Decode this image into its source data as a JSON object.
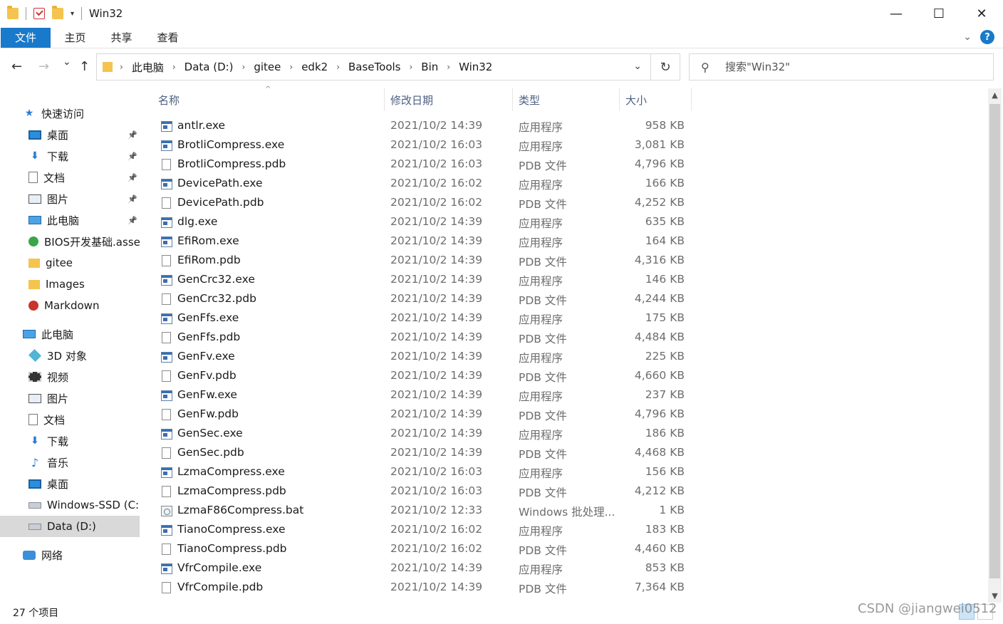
{
  "window": {
    "title": "Win32",
    "controls": {
      "minimize": "—",
      "maximize": "☐",
      "close": "✕"
    }
  },
  "ribbon": {
    "file_tab": "文件",
    "tabs": [
      "主页",
      "共享",
      "查看"
    ],
    "help": "?"
  },
  "nav": {
    "back": "←",
    "forward": "→",
    "recent": "⌄",
    "up": "↑",
    "breadcrumbs": [
      "此电脑",
      "Data (D:)",
      "gitee",
      "edk2",
      "BaseTools",
      "Bin",
      "Win32"
    ],
    "refresh": "↻",
    "search_placeholder": "搜索\"Win32\""
  },
  "sidebar": {
    "items": [
      {
        "label": "快速访问",
        "icon": "star-icon",
        "indent": 0,
        "pinned": false,
        "selected": false
      },
      {
        "label": "桌面",
        "icon": "desktop-icon",
        "indent": 1,
        "pinned": true,
        "selected": false
      },
      {
        "label": "下载",
        "icon": "download-icon",
        "indent": 1,
        "pinned": true,
        "selected": false
      },
      {
        "label": "文档",
        "icon": "document-icon",
        "indent": 1,
        "pinned": true,
        "selected": false
      },
      {
        "label": "图片",
        "icon": "picture-icon",
        "indent": 1,
        "pinned": true,
        "selected": false
      },
      {
        "label": "此电脑",
        "icon": "computer-icon",
        "indent": 1,
        "pinned": true,
        "selected": false
      },
      {
        "label": "BIOS开发基础.assets",
        "icon": "green-circle-icon",
        "indent": 1,
        "pinned": false,
        "selected": false
      },
      {
        "label": "gitee",
        "icon": "folder-icon",
        "indent": 1,
        "pinned": false,
        "selected": false
      },
      {
        "label": "Images",
        "icon": "folder-icon",
        "indent": 1,
        "pinned": false,
        "selected": false
      },
      {
        "label": "Markdown",
        "icon": "red-circle-icon",
        "indent": 1,
        "pinned": false,
        "selected": false
      },
      {
        "label": "此电脑",
        "icon": "computer-icon",
        "indent": 0,
        "pinned": false,
        "selected": false
      },
      {
        "label": "3D 对象",
        "icon": "cube-3d-icon",
        "indent": 1,
        "pinned": false,
        "selected": false
      },
      {
        "label": "视频",
        "icon": "video-icon",
        "indent": 1,
        "pinned": false,
        "selected": false
      },
      {
        "label": "图片",
        "icon": "picture-icon",
        "indent": 1,
        "pinned": false,
        "selected": false
      },
      {
        "label": "文档",
        "icon": "document-icon",
        "indent": 1,
        "pinned": false,
        "selected": false
      },
      {
        "label": "下载",
        "icon": "download-icon",
        "indent": 1,
        "pinned": false,
        "selected": false
      },
      {
        "label": "音乐",
        "icon": "music-icon",
        "indent": 1,
        "pinned": false,
        "selected": false
      },
      {
        "label": "桌面",
        "icon": "desktop-icon",
        "indent": 1,
        "pinned": false,
        "selected": false
      },
      {
        "label": "Windows-SSD (C:)",
        "icon": "drive-icon",
        "indent": 1,
        "pinned": false,
        "selected": false
      },
      {
        "label": "Data (D:)",
        "icon": "drive-icon",
        "indent": 1,
        "pinned": false,
        "selected": true
      },
      {
        "label": "网络",
        "icon": "network-icon",
        "indent": 0,
        "pinned": false,
        "selected": false
      }
    ]
  },
  "columns": {
    "name": "名称",
    "date": "修改日期",
    "type": "类型",
    "size": "大小"
  },
  "files": [
    {
      "name": "antlr.exe",
      "date": "2021/10/2 14:39",
      "type": "应用程序",
      "size": "958 KB",
      "kind": "exe"
    },
    {
      "name": "BrotliCompress.exe",
      "date": "2021/10/2 16:03",
      "type": "应用程序",
      "size": "3,081 KB",
      "kind": "exe"
    },
    {
      "name": "BrotliCompress.pdb",
      "date": "2021/10/2 16:03",
      "type": "PDB 文件",
      "size": "4,796 KB",
      "kind": "pdb"
    },
    {
      "name": "DevicePath.exe",
      "date": "2021/10/2 16:02",
      "type": "应用程序",
      "size": "166 KB",
      "kind": "exe"
    },
    {
      "name": "DevicePath.pdb",
      "date": "2021/10/2 16:02",
      "type": "PDB 文件",
      "size": "4,252 KB",
      "kind": "pdb"
    },
    {
      "name": "dlg.exe",
      "date": "2021/10/2 14:39",
      "type": "应用程序",
      "size": "635 KB",
      "kind": "exe"
    },
    {
      "name": "EfiRom.exe",
      "date": "2021/10/2 14:39",
      "type": "应用程序",
      "size": "164 KB",
      "kind": "exe"
    },
    {
      "name": "EfiRom.pdb",
      "date": "2021/10/2 14:39",
      "type": "PDB 文件",
      "size": "4,316 KB",
      "kind": "pdb"
    },
    {
      "name": "GenCrc32.exe",
      "date": "2021/10/2 14:39",
      "type": "应用程序",
      "size": "146 KB",
      "kind": "exe"
    },
    {
      "name": "GenCrc32.pdb",
      "date": "2021/10/2 14:39",
      "type": "PDB 文件",
      "size": "4,244 KB",
      "kind": "pdb"
    },
    {
      "name": "GenFfs.exe",
      "date": "2021/10/2 14:39",
      "type": "应用程序",
      "size": "175 KB",
      "kind": "exe"
    },
    {
      "name": "GenFfs.pdb",
      "date": "2021/10/2 14:39",
      "type": "PDB 文件",
      "size": "4,484 KB",
      "kind": "pdb"
    },
    {
      "name": "GenFv.exe",
      "date": "2021/10/2 14:39",
      "type": "应用程序",
      "size": "225 KB",
      "kind": "exe"
    },
    {
      "name": "GenFv.pdb",
      "date": "2021/10/2 14:39",
      "type": "PDB 文件",
      "size": "4,660 KB",
      "kind": "pdb"
    },
    {
      "name": "GenFw.exe",
      "date": "2021/10/2 14:39",
      "type": "应用程序",
      "size": "237 KB",
      "kind": "exe"
    },
    {
      "name": "GenFw.pdb",
      "date": "2021/10/2 14:39",
      "type": "PDB 文件",
      "size": "4,796 KB",
      "kind": "pdb"
    },
    {
      "name": "GenSec.exe",
      "date": "2021/10/2 14:39",
      "type": "应用程序",
      "size": "186 KB",
      "kind": "exe"
    },
    {
      "name": "GenSec.pdb",
      "date": "2021/10/2 14:39",
      "type": "PDB 文件",
      "size": "4,468 KB",
      "kind": "pdb"
    },
    {
      "name": "LzmaCompress.exe",
      "date": "2021/10/2 16:03",
      "type": "应用程序",
      "size": "156 KB",
      "kind": "exe"
    },
    {
      "name": "LzmaCompress.pdb",
      "date": "2021/10/2 16:03",
      "type": "PDB 文件",
      "size": "4,212 KB",
      "kind": "pdb"
    },
    {
      "name": "LzmaF86Compress.bat",
      "date": "2021/10/2 12:33",
      "type": "Windows 批处理...",
      "size": "1 KB",
      "kind": "bat"
    },
    {
      "name": "TianoCompress.exe",
      "date": "2021/10/2 16:02",
      "type": "应用程序",
      "size": "183 KB",
      "kind": "exe"
    },
    {
      "name": "TianoCompress.pdb",
      "date": "2021/10/2 16:02",
      "type": "PDB 文件",
      "size": "4,460 KB",
      "kind": "pdb"
    },
    {
      "name": "VfrCompile.exe",
      "date": "2021/10/2 14:39",
      "type": "应用程序",
      "size": "853 KB",
      "kind": "exe"
    },
    {
      "name": "VfrCompile.pdb",
      "date": "2021/10/2 14:39",
      "type": "PDB 文件",
      "size": "7,364 KB",
      "kind": "pdb"
    }
  ],
  "status": {
    "item_count": "27 个项目"
  },
  "watermark": "CSDN @jiangwei0512",
  "colors": {
    "accent": "#1979ca",
    "selected_bg": "#d9d9d9",
    "header_text": "#4d6082"
  }
}
